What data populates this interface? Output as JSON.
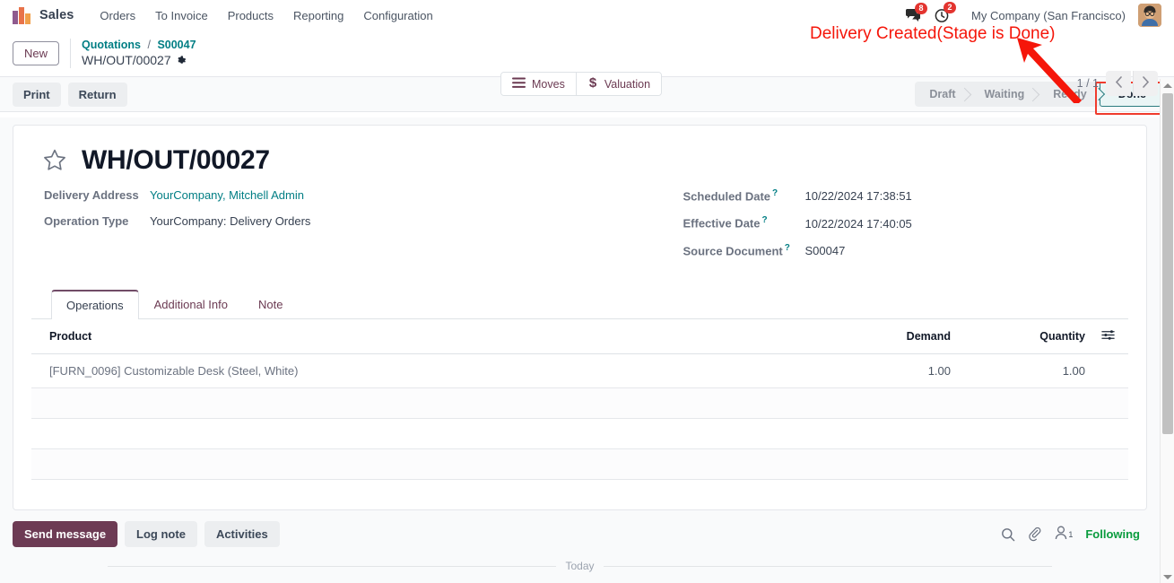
{
  "navbar": {
    "app_name": "Sales",
    "brand_icon": "odoo-sales-logo-icon",
    "menu": [
      {
        "label": "Orders"
      },
      {
        "label": "To Invoice"
      },
      {
        "label": "Products"
      },
      {
        "label": "Reporting"
      },
      {
        "label": "Configuration"
      }
    ],
    "messages": {
      "icon": "messages-icon",
      "count": "8"
    },
    "activities": {
      "icon": "activities-clock-icon",
      "count": "2"
    },
    "company": "My Company (San Francisco)",
    "avatar": "user-avatar"
  },
  "control_panel": {
    "new_button": "New",
    "breadcrumb": {
      "root": "Quotations",
      "separator": "/",
      "parent": "S00047",
      "current": "WH/OUT/00027",
      "gear_icon": "gear-icon"
    },
    "stat_buttons": [
      {
        "label": "Moves",
        "icon": "bars-icon"
      },
      {
        "label": "Valuation",
        "icon": "dollar-icon"
      }
    ],
    "pager": {
      "text": "1 / 1",
      "prev_icon": "chevron-left-icon",
      "next_icon": "chevron-right-icon"
    }
  },
  "action_bar": {
    "buttons": [
      {
        "label": "Print"
      },
      {
        "label": "Return"
      }
    ],
    "status_steps": [
      {
        "label": "Draft",
        "active": false
      },
      {
        "label": "Waiting",
        "active": false
      },
      {
        "label": "Ready",
        "active": false
      },
      {
        "label": "Done",
        "active": true
      }
    ]
  },
  "record": {
    "star_icon": "favorite-star-icon",
    "title": "WH/OUT/00027",
    "left_fields": [
      {
        "label": "Delivery Address",
        "value": "YourCompany, Mitchell Admin",
        "link": true,
        "help": false
      },
      {
        "label": "Operation Type",
        "value": "YourCompany: Delivery Orders",
        "link": false,
        "help": false
      }
    ],
    "right_fields": [
      {
        "label": "Scheduled Date",
        "value": "10/22/2024 17:38:51",
        "link": false,
        "help": true
      },
      {
        "label": "Effective Date",
        "value": "10/22/2024 17:40:05",
        "link": false,
        "help": true
      },
      {
        "label": "Source Document",
        "value": "S00047",
        "link": false,
        "help": true
      }
    ]
  },
  "notebook": {
    "tabs": [
      {
        "label": "Operations",
        "active": true
      },
      {
        "label": "Additional Info",
        "active": false
      },
      {
        "label": "Note",
        "active": false
      }
    ],
    "table": {
      "headers": {
        "product": "Product",
        "demand": "Demand",
        "quantity": "Quantity",
        "options_icon": "column-options-icon"
      },
      "rows": [
        {
          "product": "[FURN_0096] Customizable Desk (Steel, White)",
          "demand": "1.00",
          "quantity": "1.00"
        }
      ],
      "empty_row_count": 4
    }
  },
  "chatter": {
    "buttons": [
      {
        "label": "Send message",
        "primary": true
      },
      {
        "label": "Log note",
        "primary": false
      },
      {
        "label": "Activities",
        "primary": false
      }
    ],
    "search_icon": "search-icon",
    "attachment_icon": "paperclip-icon",
    "followers_icon": "followers-person-icon",
    "followers_count": "1",
    "following_label": "Following",
    "today_separator": "Today"
  },
  "annotation": {
    "text": "Delivery Created(Stage is Done)",
    "color": "#f5160a",
    "arrow_icon": "red-arrow-icon"
  },
  "scrollbar": {
    "up_icon": "scroll-up-arrow-icon",
    "down_icon": "scroll-down-arrow-icon",
    "thumb": "scroll-thumb"
  }
}
